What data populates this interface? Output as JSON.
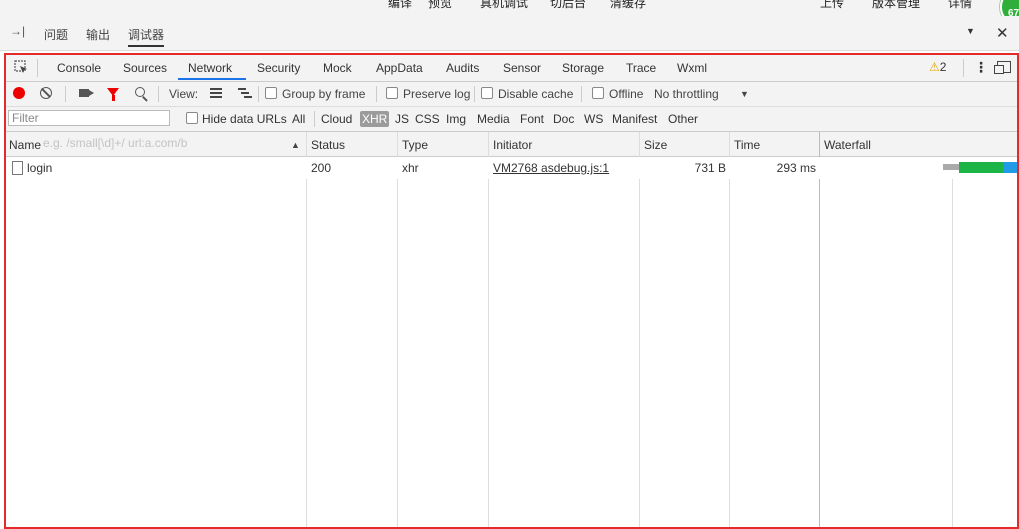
{
  "top_toolbar": {
    "items": [
      "编译",
      "预览",
      "真机调试",
      "切后台",
      "清缓存",
      "上传",
      "版本管理",
      "详情"
    ],
    "badge": "67"
  },
  "panel_tabs": {
    "items": [
      "问题",
      "输出",
      "调试器"
    ],
    "active": "调试器"
  },
  "devtools_tabs": {
    "items": [
      "Console",
      "Sources",
      "Network",
      "Security",
      "Mock",
      "AppData",
      "Audits",
      "Sensor",
      "Storage",
      "Trace",
      "Wxml"
    ],
    "active": "Network",
    "warning_count": "2",
    "active_color": "#1a73e8"
  },
  "network_toolbar": {
    "view_label": "View:",
    "group_by_frame": "Group by frame",
    "preserve_log": "Preserve log",
    "disable_cache": "Disable cache",
    "offline": "Offline",
    "throttling": "No throttling",
    "record_color": "#e00000"
  },
  "filter_bar": {
    "placeholder": "Filter",
    "hint": "e.g. /small[\\d]+/ url:a.com/b",
    "hide_data_urls": "Hide data URLs",
    "types": [
      "All",
      "Cloud",
      "XHR",
      "JS",
      "CSS",
      "Img",
      "Media",
      "Font",
      "Doc",
      "WS",
      "Manifest",
      "Other"
    ],
    "active_type": "XHR"
  },
  "table": {
    "columns": [
      "Name",
      "Status",
      "Type",
      "Initiator",
      "Size",
      "Time",
      "Waterfall"
    ],
    "rows": [
      {
        "name": "login",
        "status": "200",
        "type": "xhr",
        "initiator": "VM2768 asdebug.js:1",
        "size": "731 B",
        "time": "293 ms"
      }
    ]
  },
  "colors": {
    "frame_highlight": "#e32b2b",
    "waterfall_wait": "#aaaaaa",
    "waterfall_ttfb": "#1db447",
    "waterfall_download": "#1f9be8"
  }
}
